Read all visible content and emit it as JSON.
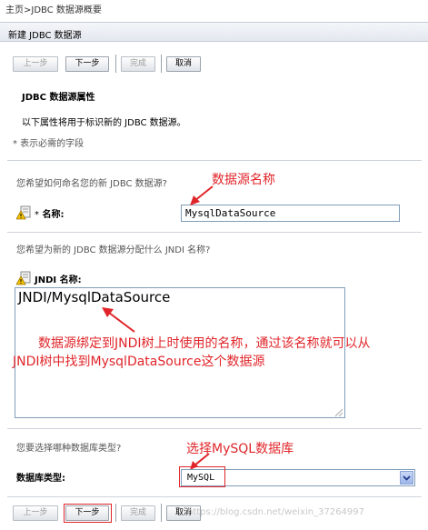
{
  "breadcrumb": {
    "home": "主页",
    "current": ">JDBC 数据源概要"
  },
  "window": {
    "title": "新建 JDBC 数据源"
  },
  "toolbar_top": {
    "back": "上一步",
    "next": "下一步",
    "finish": "完成",
    "cancel": "取消"
  },
  "section": {
    "title": "JDBC 数据源属性",
    "description": "以下属性将用于标识新的 JDBC 数据源。",
    "required_note": "* 表示必需的字段"
  },
  "name_field": {
    "question": "您希望如何命名您的新 JDBC 数据源?",
    "required_mark": "*",
    "label": "名称:",
    "value": "MysqlDataSource"
  },
  "jndi_field": {
    "question": "您希望为新的 JDBC 数据源分配什么 JNDI 名称?",
    "label": "JNDI 名称:",
    "value": "JNDI/MysqlDataSource"
  },
  "db_type_field": {
    "question": "您要选择哪种数据库类型?",
    "label": "数据库类型:",
    "value": "MySQL"
  },
  "toolbar_bottom": {
    "back": "上一步",
    "next": "下一步",
    "finish": "完成",
    "cancel": "取消"
  },
  "annotations": {
    "name": "数据源名称",
    "jndi_line1": "数据源绑定到JNDI树上时使用的名称，通过该名称就可以从",
    "jndi_line2": "JNDI树中找到MysqlDataSource这个数据源",
    "db_type": "选择MySQL数据库"
  },
  "watermark": "https://blog.csdn.net/weixin_37264997",
  "colors": {
    "annotation": "#e0252a",
    "titlebar": "#e3e8ef",
    "input_border": "#7f9db9"
  }
}
